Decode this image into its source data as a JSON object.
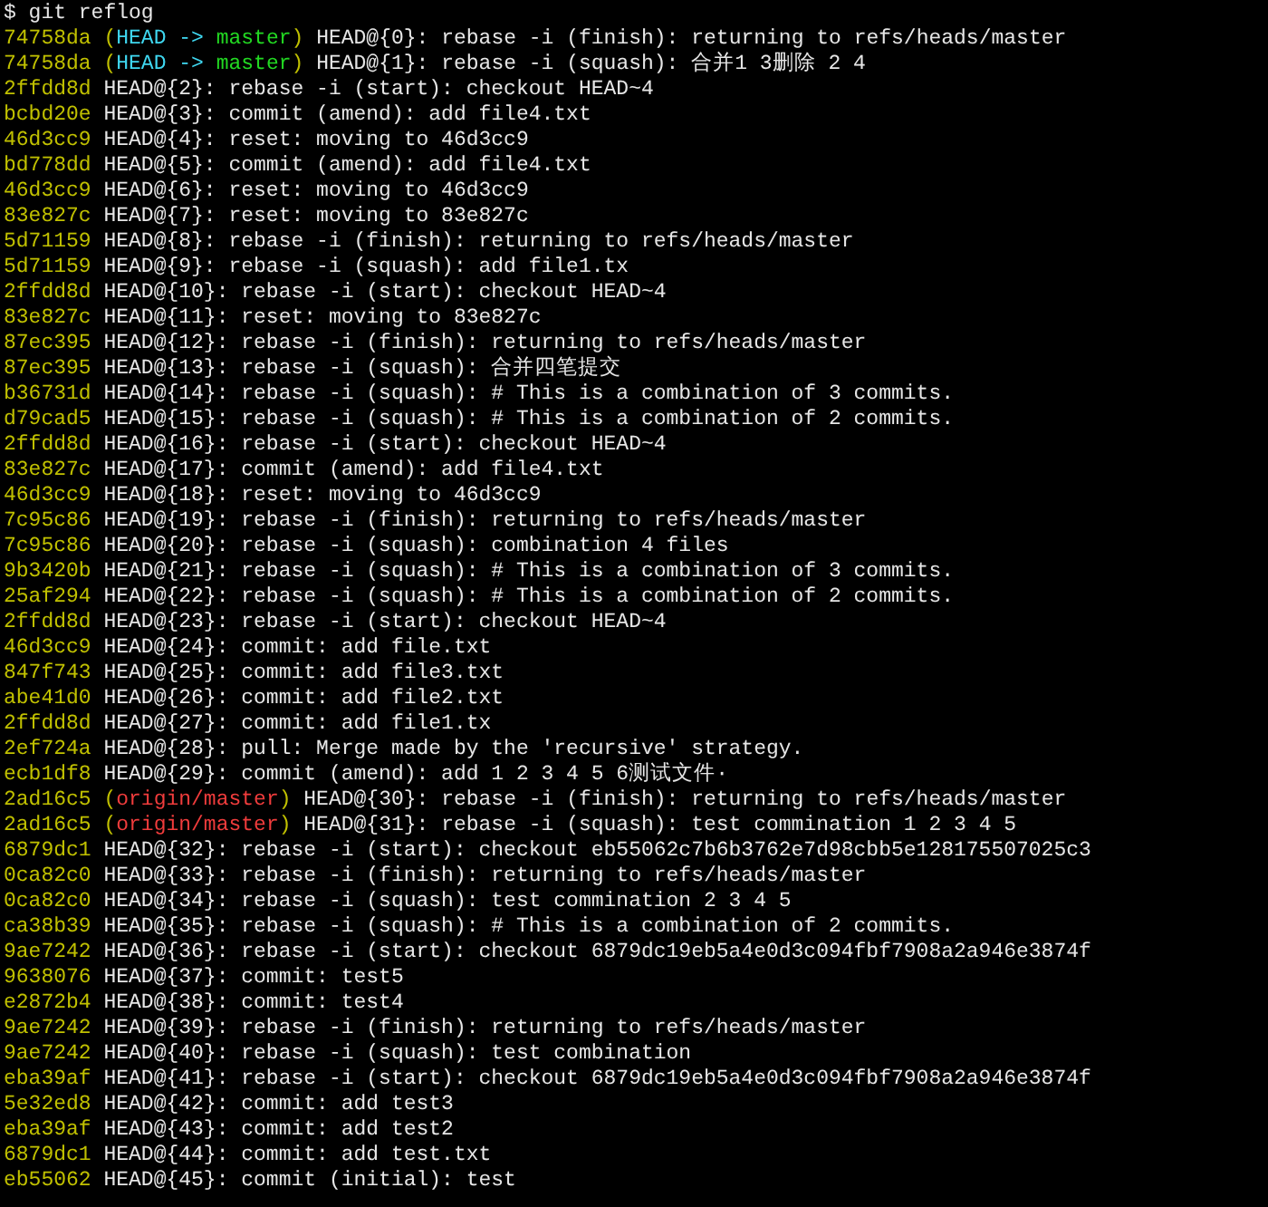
{
  "prompt": "$ git reflog",
  "lines": [
    {
      "hash": "74758da",
      "refs": [
        {
          "kind": "paren",
          "text": "("
        },
        {
          "kind": "head",
          "text": "HEAD -> "
        },
        {
          "kind": "local_branch",
          "text": "master"
        },
        {
          "kind": "paren",
          "text": ")"
        }
      ],
      "text": "HEAD@{0}: rebase -i (finish): returning to refs/heads/master"
    },
    {
      "hash": "74758da",
      "refs": [
        {
          "kind": "paren",
          "text": "("
        },
        {
          "kind": "head",
          "text": "HEAD -> "
        },
        {
          "kind": "local_branch",
          "text": "master"
        },
        {
          "kind": "paren",
          "text": ")"
        }
      ],
      "text": "HEAD@{1}: rebase -i (squash): 合并1 3删除 2 4"
    },
    {
      "hash": "2ffdd8d",
      "text": "HEAD@{2}: rebase -i (start): checkout HEAD~4"
    },
    {
      "hash": "bcbd20e",
      "text": "HEAD@{3}: commit (amend): add file4.txt"
    },
    {
      "hash": "46d3cc9",
      "text": "HEAD@{4}: reset: moving to 46d3cc9"
    },
    {
      "hash": "bd778dd",
      "text": "HEAD@{5}: commit (amend): add file4.txt"
    },
    {
      "hash": "46d3cc9",
      "text": "HEAD@{6}: reset: moving to 46d3cc9"
    },
    {
      "hash": "83e827c",
      "text": "HEAD@{7}: reset: moving to 83e827c"
    },
    {
      "hash": "5d71159",
      "text": "HEAD@{8}: rebase -i (finish): returning to refs/heads/master"
    },
    {
      "hash": "5d71159",
      "text": "HEAD@{9}: rebase -i (squash): add file1.tx"
    },
    {
      "hash": "2ffdd8d",
      "text": "HEAD@{10}: rebase -i (start): checkout HEAD~4"
    },
    {
      "hash": "83e827c",
      "text": "HEAD@{11}: reset: moving to 83e827c"
    },
    {
      "hash": "87ec395",
      "text": "HEAD@{12}: rebase -i (finish): returning to refs/heads/master"
    },
    {
      "hash": "87ec395",
      "text": "HEAD@{13}: rebase -i (squash): 合并四笔提交"
    },
    {
      "hash": "b36731d",
      "text": "HEAD@{14}: rebase -i (squash): # This is a combination of 3 commits."
    },
    {
      "hash": "d79cad5",
      "text": "HEAD@{15}: rebase -i (squash): # This is a combination of 2 commits."
    },
    {
      "hash": "2ffdd8d",
      "text": "HEAD@{16}: rebase -i (start): checkout HEAD~4"
    },
    {
      "hash": "83e827c",
      "text": "HEAD@{17}: commit (amend): add file4.txt"
    },
    {
      "hash": "46d3cc9",
      "text": "HEAD@{18}: reset: moving to 46d3cc9"
    },
    {
      "hash": "7c95c86",
      "text": "HEAD@{19}: rebase -i (finish): returning to refs/heads/master"
    },
    {
      "hash": "7c95c86",
      "text": "HEAD@{20}: rebase -i (squash): combination 4 files"
    },
    {
      "hash": "9b3420b",
      "text": "HEAD@{21}: rebase -i (squash): # This is a combination of 3 commits."
    },
    {
      "hash": "25af294",
      "text": "HEAD@{22}: rebase -i (squash): # This is a combination of 2 commits."
    },
    {
      "hash": "2ffdd8d",
      "text": "HEAD@{23}: rebase -i (start): checkout HEAD~4"
    },
    {
      "hash": "46d3cc9",
      "text": "HEAD@{24}: commit: add file.txt"
    },
    {
      "hash": "847f743",
      "text": "HEAD@{25}: commit: add file3.txt"
    },
    {
      "hash": "abe41d0",
      "text": "HEAD@{26}: commit: add file2.txt"
    },
    {
      "hash": "2ffdd8d",
      "text": "HEAD@{27}: commit: add file1.tx"
    },
    {
      "hash": "2ef724a",
      "text": "HEAD@{28}: pull: Merge made by the 'recursive' strategy."
    },
    {
      "hash": "ecb1df8",
      "text": "HEAD@{29}: commit (amend): add 1 2 3 4 5 6测试文件·"
    },
    {
      "hash": "2ad16c5",
      "refs": [
        {
          "kind": "paren",
          "text": "("
        },
        {
          "kind": "remote_branch",
          "text": "origin/master"
        },
        {
          "kind": "paren",
          "text": ")"
        }
      ],
      "text": "HEAD@{30}: rebase -i (finish): returning to refs/heads/master"
    },
    {
      "hash": "2ad16c5",
      "refs": [
        {
          "kind": "paren",
          "text": "("
        },
        {
          "kind": "remote_branch",
          "text": "origin/master"
        },
        {
          "kind": "paren",
          "text": ")"
        }
      ],
      "text": "HEAD@{31}: rebase -i (squash): test commination 1 2 3 4 5"
    },
    {
      "hash": "6879dc1",
      "text": "HEAD@{32}: rebase -i (start): checkout eb55062c7b6b3762e7d98cbb5e128175507025c3"
    },
    {
      "hash": "0ca82c0",
      "text": "HEAD@{33}: rebase -i (finish): returning to refs/heads/master"
    },
    {
      "hash": "0ca82c0",
      "text": "HEAD@{34}: rebase -i (squash): test commination 2 3 4 5"
    },
    {
      "hash": "ca38b39",
      "text": "HEAD@{35}: rebase -i (squash): # This is a combination of 2 commits."
    },
    {
      "hash": "9ae7242",
      "text": "HEAD@{36}: rebase -i (start): checkout 6879dc19eb5a4e0d3c094fbf7908a2a946e3874f"
    },
    {
      "hash": "9638076",
      "text": "HEAD@{37}: commit: test5"
    },
    {
      "hash": "e2872b4",
      "text": "HEAD@{38}: commit: test4"
    },
    {
      "hash": "9ae7242",
      "text": "HEAD@{39}: rebase -i (finish): returning to refs/heads/master"
    },
    {
      "hash": "9ae7242",
      "text": "HEAD@{40}: rebase -i (squash): test combination"
    },
    {
      "hash": "eba39af",
      "text": "HEAD@{41}: rebase -i (start): checkout 6879dc19eb5a4e0d3c094fbf7908a2a946e3874f"
    },
    {
      "hash": "5e32ed8",
      "text": "HEAD@{42}: commit: add test3"
    },
    {
      "hash": "eba39af",
      "text": "HEAD@{43}: commit: add test2"
    },
    {
      "hash": "6879dc1",
      "text": "HEAD@{44}: commit: add test.txt"
    },
    {
      "hash": "eb55062",
      "text": "HEAD@{45}: commit (initial): test"
    }
  ]
}
